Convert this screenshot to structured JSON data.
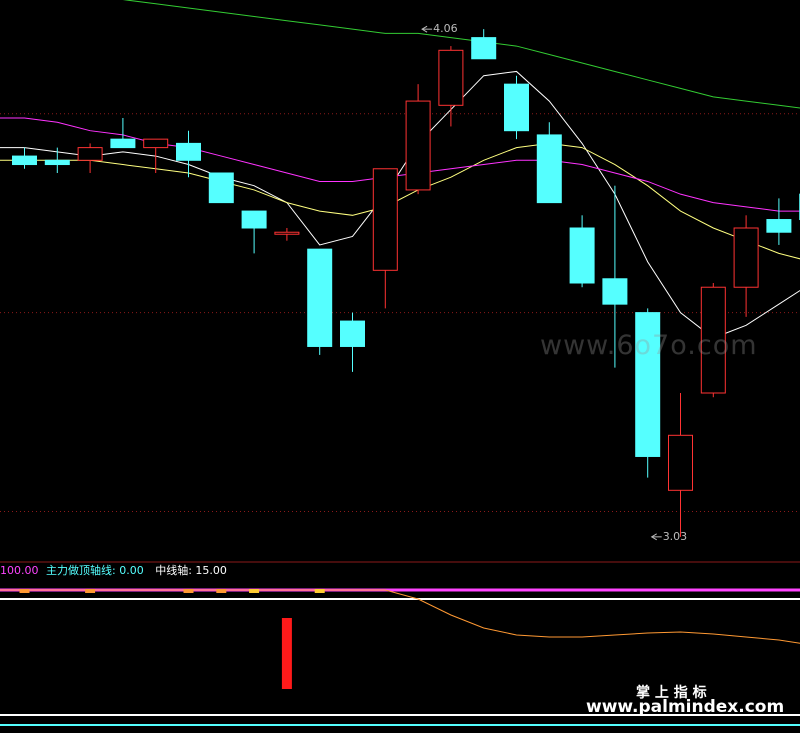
{
  "chart_data": [
    {
      "type": "candlestick",
      "ohlc": [
        {
          "open": 3.93,
          "high": 3.95,
          "low": 3.9,
          "close": 3.91
        },
        {
          "open": 3.92,
          "high": 3.95,
          "low": 3.89,
          "close": 3.91
        },
        {
          "open": 3.92,
          "high": 3.96,
          "low": 3.89,
          "close": 3.95
        },
        {
          "open": 3.97,
          "high": 4.02,
          "low": 3.95,
          "close": 3.95
        },
        {
          "open": 3.95,
          "high": 3.97,
          "low": 3.89,
          "close": 3.97
        },
        {
          "open": 3.96,
          "high": 3.99,
          "low": 3.88,
          "close": 3.92
        },
        {
          "open": 3.89,
          "high": 3.89,
          "low": 3.82,
          "close": 3.82
        },
        {
          "open": 3.8,
          "high": 3.8,
          "low": 3.7,
          "close": 3.76
        },
        {
          "open": 3.75,
          "high": 3.76,
          "low": 3.73,
          "close": 3.75
        },
        {
          "open": 3.71,
          "high": 3.71,
          "low": 3.46,
          "close": 3.48
        },
        {
          "open": 3.54,
          "high": 3.56,
          "low": 3.42,
          "close": 3.48
        },
        {
          "open": 3.66,
          "high": 3.9,
          "low": 3.57,
          "close": 3.9
        },
        {
          "open": 3.85,
          "high": 4.1,
          "low": 3.84,
          "close": 4.06
        },
        {
          "open": 4.05,
          "high": 4.19,
          "low": 4.0,
          "close": 4.18
        },
        {
          "open": 4.21,
          "high": 4.23,
          "low": 4.16,
          "close": 4.16
        },
        {
          "open": 4.1,
          "high": 4.12,
          "low": 3.97,
          "close": 3.99
        },
        {
          "open": 3.98,
          "high": 4.01,
          "low": 3.82,
          "close": 3.82
        },
        {
          "open": 3.76,
          "high": 3.79,
          "low": 3.62,
          "close": 3.63
        },
        {
          "open": 3.64,
          "high": 3.86,
          "low": 3.43,
          "close": 3.58
        },
        {
          "open": 3.56,
          "high": 3.57,
          "low": 3.17,
          "close": 3.22
        },
        {
          "open": 3.14,
          "high": 3.37,
          "low": 3.03,
          "close": 3.27
        },
        {
          "open": 3.37,
          "high": 3.63,
          "low": 3.36,
          "close": 3.62
        },
        {
          "open": 3.62,
          "high": 3.79,
          "low": 3.55,
          "close": 3.76
        },
        {
          "open": 3.78,
          "high": 3.83,
          "low": 3.72,
          "close": 3.75
        },
        {
          "open": 3.84,
          "high": 3.84,
          "low": 3.75,
          "close": 3.78
        }
      ],
      "moving_averages": [
        {
          "color": "#ffffff",
          "values": [
            3.95,
            3.94,
            3.93,
            3.94,
            3.93,
            3.91,
            3.88,
            3.86,
            3.82,
            3.72,
            3.74,
            3.84,
            3.96,
            4.04,
            4.12,
            4.13,
            4.06,
            3.96,
            3.84,
            3.68,
            3.56,
            3.5,
            3.53,
            3.58,
            3.63
          ]
        },
        {
          "color": "#ffff80",
          "values": [
            3.92,
            3.92,
            3.92,
            3.91,
            3.9,
            3.89,
            3.87,
            3.85,
            3.82,
            3.8,
            3.79,
            3.81,
            3.85,
            3.88,
            3.92,
            3.95,
            3.96,
            3.95,
            3.91,
            3.86,
            3.8,
            3.76,
            3.73,
            3.7,
            3.68
          ]
        },
        {
          "color": "#ff33ff",
          "values": [
            4.02,
            4.01,
            3.99,
            3.98,
            3.96,
            3.95,
            3.93,
            3.91,
            3.89,
            3.87,
            3.87,
            3.88,
            3.89,
            3.9,
            3.91,
            3.92,
            3.92,
            3.91,
            3.89,
            3.87,
            3.84,
            3.82,
            3.81,
            3.8,
            3.8
          ]
        },
        {
          "color": "#33cc33",
          "values": [
            4.33,
            4.32,
            4.31,
            4.3,
            4.29,
            4.28,
            4.27,
            4.26,
            4.25,
            4.24,
            4.23,
            4.22,
            4.22,
            4.21,
            4.2,
            4.19,
            4.17,
            4.15,
            4.13,
            4.11,
            4.09,
            4.07,
            4.06,
            4.05,
            4.04
          ]
        }
      ],
      "annotations": [
        {
          "text": "4.06",
          "index": 12,
          "value": 4.23,
          "color": "#bbbbbb"
        },
        {
          "text": "3.03",
          "index": 19,
          "value": 3.03,
          "color": "#bbbbbb"
        }
      ],
      "ylim": [
        2.98,
        4.28
      ],
      "gridlines": [
        4.03,
        3.56,
        3.09
      ],
      "colors": {
        "up": "#ff3333",
        "down": "#55ffff",
        "grid": "#8b1a1a"
      }
    },
    {
      "type": "indicator",
      "legend": [
        {
          "text": "100.00",
          "color": "#ff44ff"
        },
        {
          "text": "主力做顶轴线: 0.00",
          "color": "#55ffff"
        },
        {
          "text": "中线轴: 15.00",
          "color": "#ffffff"
        }
      ],
      "ylim": [
        -40,
        100
      ],
      "top_line": {
        "value": 100,
        "color": "#ff44ff"
      },
      "white_lines": [
        {
          "value": 91,
          "color": "#ffffff"
        },
        {
          "value": -25,
          "color": "#ffffff"
        }
      ],
      "bottom_line": {
        "value": -35,
        "color": "#55ffff"
      },
      "orange_line": {
        "color": "#ff9933",
        "values": [
          100,
          100,
          100,
          100,
          100,
          100,
          100,
          100,
          100,
          100,
          100,
          100,
          91,
          75,
          62,
          55,
          53,
          53,
          55,
          57,
          58,
          56,
          53,
          50,
          45
        ]
      },
      "red_bar": {
        "index": 8,
        "value": 1,
        "color": "#ff1a1a"
      },
      "markers": [
        {
          "index": 0,
          "color": "#ff9933"
        },
        {
          "index": 2,
          "color": "#ff9933"
        },
        {
          "index": 5,
          "color": "#ff9933"
        },
        {
          "index": 6,
          "color": "#ff9933"
        },
        {
          "index": 7,
          "color": "#ffcc33"
        },
        {
          "index": 9,
          "color": "#ffcc33"
        }
      ]
    }
  ],
  "watermarks": {
    "center": "www.6o7o.com",
    "brand": "掌 上 指 标",
    "url": "www.palmindex.com"
  }
}
